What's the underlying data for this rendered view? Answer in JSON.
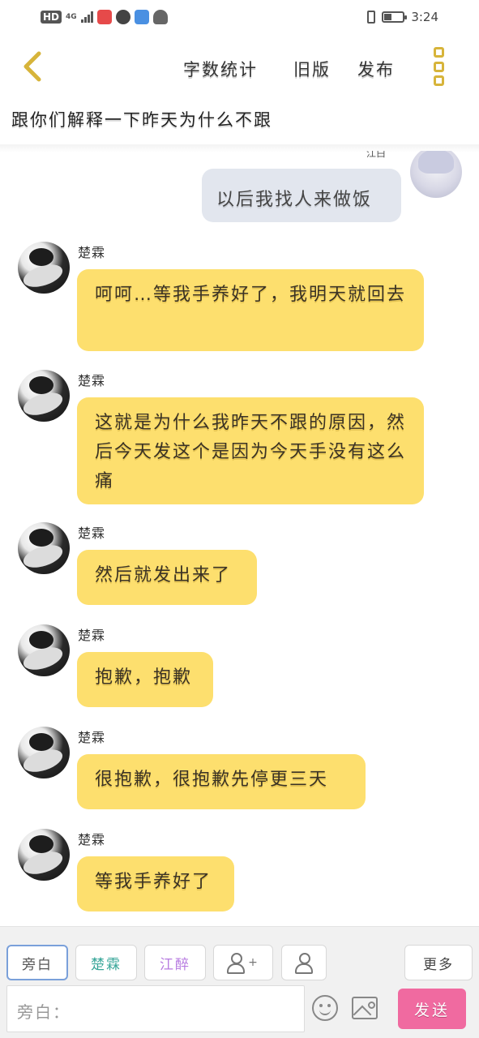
{
  "status_bar": {
    "hd": "HD",
    "network": "4G",
    "time": "3:24",
    "colors": {
      "app1": "#e64a4a",
      "app2": "#4a90e2"
    }
  },
  "header": {
    "back_icon": "chevron-left-icon",
    "word_count_label": "字数统计",
    "old_version_label": "旧版",
    "publish_label": "发布",
    "more_icon": "more-icon"
  },
  "title": "跟你们解释一下昨天为什么不跟",
  "mine": {
    "name": "江白",
    "text": "以后我找人来做饭"
  },
  "messages": [
    {
      "sender": "楚霖",
      "text": "呵呵…等我手养好了，我明天就回去"
    },
    {
      "sender": "楚霖",
      "text": "这就是为什么我昨天不跟的原因，然后今天发这个是因为今天手没有这么痛"
    },
    {
      "sender": "楚霖",
      "text": "然后就发出来了"
    },
    {
      "sender": "楚霖",
      "text": "抱歉，抱歉"
    },
    {
      "sender": "楚霖",
      "text": "很抱歉，很抱歉先停更三天"
    },
    {
      "sender": "楚霖",
      "text": "等我手养好了"
    }
  ],
  "toolbar": {
    "roles": [
      {
        "label": "旁白",
        "color": "#555555"
      },
      {
        "label": "楚霖",
        "color": "#3aa79a"
      },
      {
        "label": "江醉",
        "color": "#b77be0"
      }
    ],
    "add_role_icon": "add-person-icon",
    "person_icon": "person-icon",
    "more_label": "更多",
    "input_placeholder": "旁白：",
    "send_label": "发送"
  },
  "colors": {
    "bubble_other": "#fddf6e",
    "bubble_mine": "#e2e6ee",
    "send_button": "#f06aa0",
    "accent": "#d7b43a"
  }
}
